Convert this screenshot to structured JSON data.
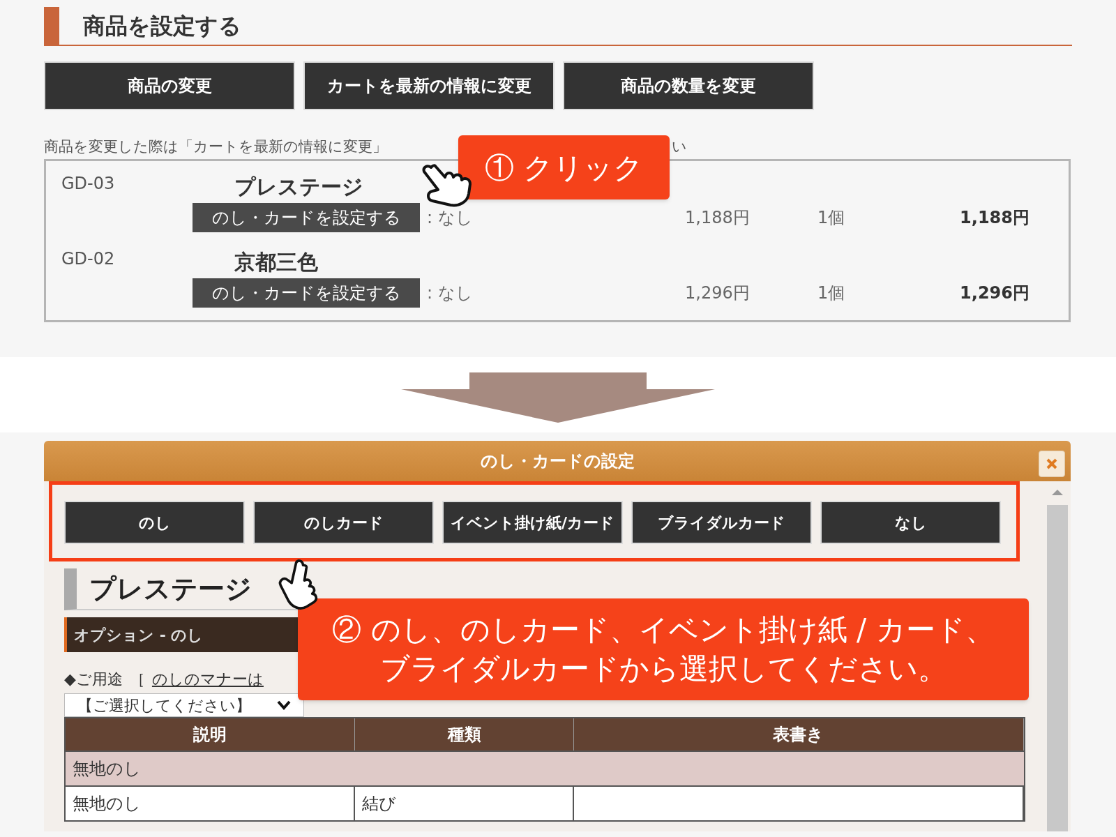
{
  "top_panel": {
    "heading": "商品を設定する",
    "buttons": [
      "商品の変更",
      "カートを最新の情報に変更",
      "商品の数量を変更"
    ],
    "note": "商品を変更した際は「カートを最新の情報に変更」",
    "note_tail": "い",
    "items": [
      {
        "code": "GD-03",
        "name": "プレステージ",
        "noshi_button": "のし・カードを設定する",
        "noshi_value": ": なし",
        "price": "1,188円",
        "quantity": "1個",
        "subtotal": "1,188円"
      },
      {
        "code": "GD-02",
        "name": "京都三色",
        "noshi_button": "のし・カードを設定する",
        "noshi_value": ": なし",
        "price": "1,296円",
        "quantity": "1個",
        "subtotal": "1,296円"
      }
    ],
    "callout": {
      "lines": [
        "① クリック"
      ]
    }
  },
  "dialog": {
    "title": "のし・カードの設定",
    "options": [
      "のし",
      "のしカード",
      "イベント掛け紙/カード",
      "ブライダルカード",
      "なし"
    ],
    "product_heading": "プレステージ",
    "section_bar": "オプション - のし",
    "usage_label": "◆ご用途",
    "bracket": "［",
    "manner_link": "のしのマナーは",
    "select": {
      "value": "【ご選択してください】"
    },
    "table": {
      "columns": [
        "説明",
        "種類",
        "表書き"
      ],
      "rows": [
        {
          "kind": "group",
          "cells": [
            "無地のし"
          ]
        },
        {
          "kind": "item",
          "cells": [
            "無地のし",
            "結び"
          ]
        }
      ]
    },
    "callout": {
      "lines": [
        "② のし、のしカード、イベント掛け紙 / カード、",
        "ブライダルカードから選択してください。"
      ]
    }
  }
}
